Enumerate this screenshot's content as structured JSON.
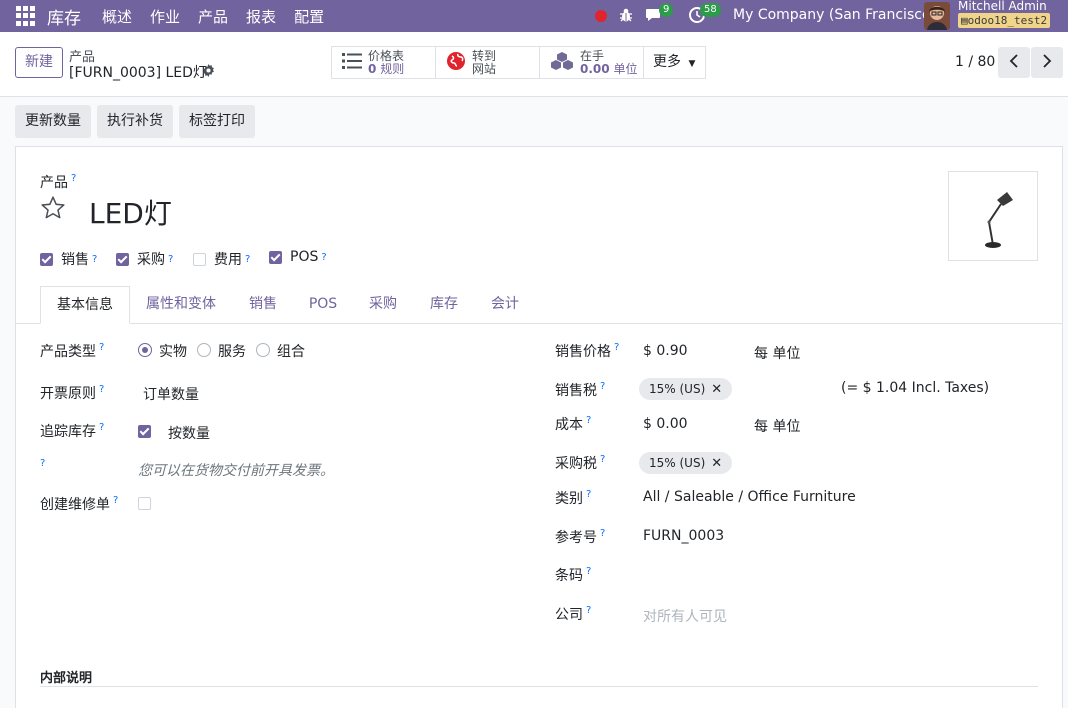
{
  "nav": {
    "brand": "库存",
    "menu": [
      "概述",
      "作业",
      "产品",
      "报表",
      "配置"
    ],
    "chat_count": "9",
    "activity_count": "58",
    "company": "My Company (San Francisco)",
    "user": "Mitchell Admin",
    "db": "odoo18_test2"
  },
  "control": {
    "new_label": "新建",
    "breadcrumb_parent": "产品",
    "breadcrumb_current": "[FURN_0003] LED灯",
    "smart": {
      "pricelist_title": "价格表",
      "pricelist_count": "0",
      "pricelist_unit": "规则",
      "website_l1": "转到",
      "website_l2": "网站",
      "onhand_title": "在手",
      "onhand_qty": "0.00",
      "onhand_unit": "单位"
    },
    "more_label": "更多",
    "pager": "1 / 80"
  },
  "actions": [
    "更新数量",
    "执行补货",
    "标签打印"
  ],
  "product": {
    "label": "产品",
    "name": "LED灯",
    "flags": [
      {
        "label": "销售",
        "checked": true
      },
      {
        "label": "采购",
        "checked": true
      },
      {
        "label": "费用",
        "checked": false
      },
      {
        "label": "POS",
        "checked": true
      }
    ]
  },
  "tabs": [
    "基本信息",
    "属性和变体",
    "销售",
    "POS",
    "采购",
    "库存",
    "会计"
  ],
  "left": {
    "product_type_label": "产品类型",
    "product_type_options": [
      "实物",
      "服务",
      "组合"
    ],
    "invoice_policy_label": "开票原则",
    "invoice_policy_value": "订单数量",
    "track_inventory_label": "追踪库存",
    "track_inventory_value": "按数量",
    "invoice_hint": "您可以在货物交付前开具发票。",
    "repair_label": "创建维修单"
  },
  "right": {
    "sales_price_label": "销售价格",
    "sales_price_value": "$ 0.90",
    "sales_price_per": "每  单位",
    "sales_tax_label": "销售税",
    "sales_tax_tag": "15% (US)",
    "sales_tax_incl": "(= $ 1.04 Incl. Taxes)",
    "cost_label": "成本",
    "cost_value": "$ 0.00",
    "cost_per": "每  单位",
    "purchase_tax_label": "采购税",
    "purchase_tax_tag": "15% (US)",
    "category_label": "类别",
    "category_value": "All / Saleable / Office Furniture",
    "ref_label": "参考号",
    "ref_value": "FURN_0003",
    "barcode_label": "条码",
    "company_label": "公司",
    "company_placeholder": "对所有人可见"
  },
  "internal_notes_label": "内部说明",
  "colors": {
    "brand": "#71639e",
    "link": "#0d6efd",
    "badge": "#2c9b4a"
  }
}
